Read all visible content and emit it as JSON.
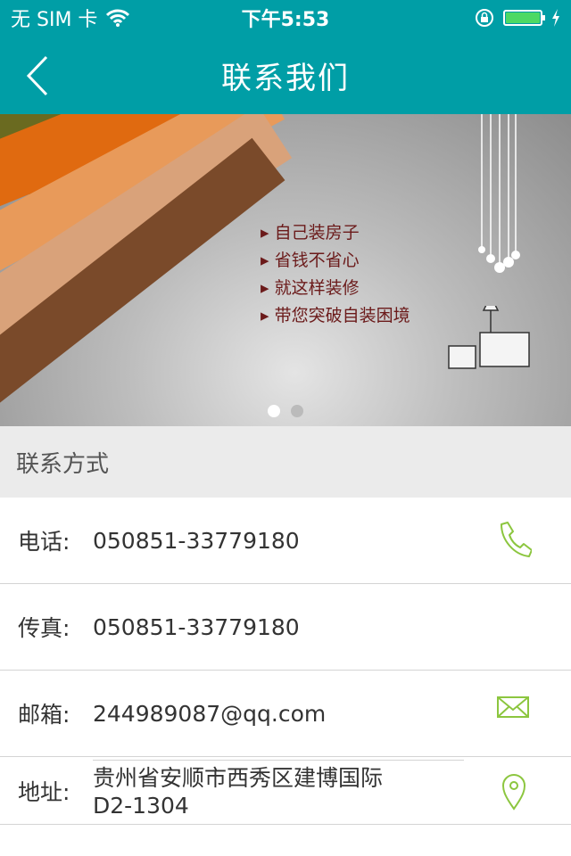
{
  "status_bar": {
    "carrier": "无 SIM 卡",
    "time": "下午5:53",
    "battery_percent": 100
  },
  "nav": {
    "title": "联系我们",
    "back_icon": "chevron-left-icon"
  },
  "banner": {
    "slogans": [
      "自己装房子",
      "省钱不省心",
      "就这样装修",
      "带您突破自装困境"
    ],
    "slide_count": 2,
    "active_slide": 1
  },
  "section": {
    "title": "联系方式"
  },
  "contacts": [
    {
      "label": "电话:",
      "value": "050851-33779180",
      "icon": "phone-icon"
    },
    {
      "label": "传真:",
      "value": "050851-33779180"
    },
    {
      "label": "邮箱:",
      "value": "244989087@qq.com",
      "icon": "mail-icon"
    },
    {
      "label": "地址:",
      "value": "贵州省安顺市西秀区建博国际\nD2-1304",
      "icon": "map-pin-icon"
    }
  ],
  "colors": {
    "header": "#009ea6",
    "icon_accent": "#8cc63f"
  }
}
